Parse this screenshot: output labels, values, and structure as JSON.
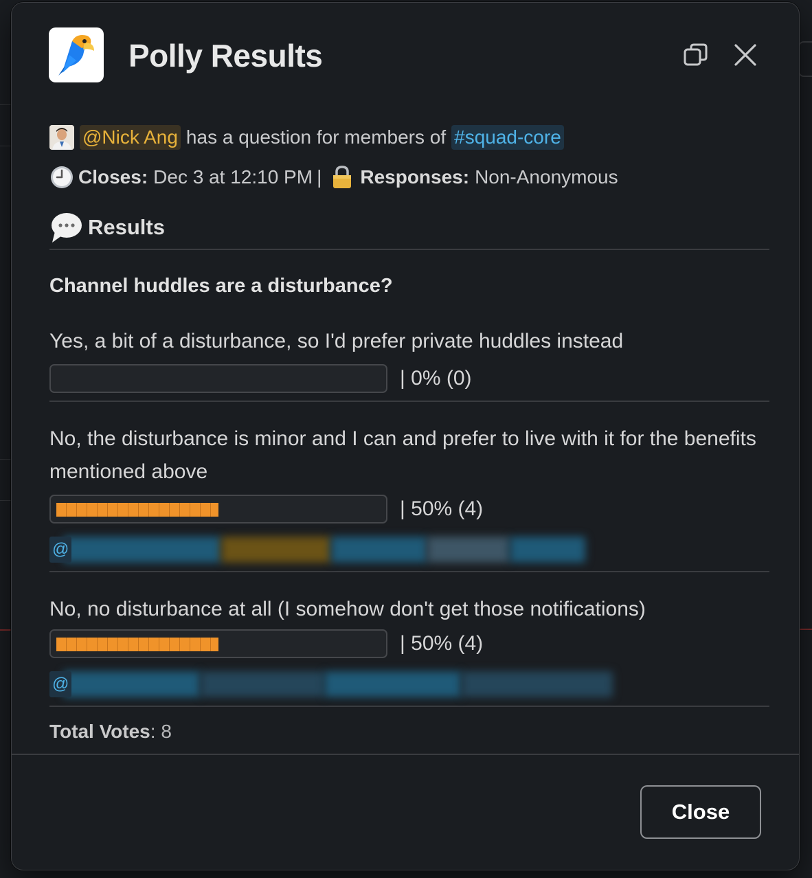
{
  "modal": {
    "title": "Polly Results",
    "close_button_label": "Close"
  },
  "poll": {
    "asker_mention": "@Nick Ang",
    "asker_text": "has a question for members of",
    "channel": "#squad-core",
    "closes_label": "Closes:",
    "closes_value": "Dec 3 at 12:10 PM",
    "separator": "|",
    "responses_label": "Responses:",
    "responses_value": "Non-Anonymous",
    "results_label": "Results",
    "question": "Channel huddles are a disturbance?",
    "options": [
      {
        "text": "Yes, a bit of a disturbance, so I'd prefer private huddles instead",
        "percent_text": "|  0% (0)",
        "fraction": 0.0
      },
      {
        "text": "No, the disturbance is minor and I can and prefer to live with it for the benefits mentioned above",
        "percent_text": "|  50% (4)",
        "fraction": 0.5,
        "voters_prefix": "@"
      },
      {
        "text": "No, no disturbance at all (I somehow don't get those notifications)",
        "percent_text": "|  50% (4)",
        "fraction": 0.5,
        "voters_prefix": "@"
      }
    ],
    "total_votes_label": "Total Votes",
    "total_votes_value": ": 8"
  },
  "colors": {
    "bar_fill": "#f0932a",
    "mention_text": "#e8b23a",
    "channel_text": "#4fb3e8"
  },
  "icons": [
    "polly-logo-icon",
    "popout-icon",
    "close-icon",
    "clock-icon",
    "lock-icon",
    "speech-bubble-icon"
  ]
}
